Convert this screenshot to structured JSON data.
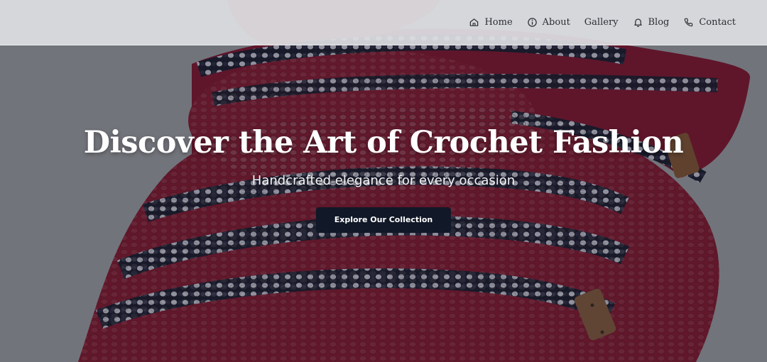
{
  "nav": {
    "items": [
      {
        "label": "Home",
        "icon": "home-icon"
      },
      {
        "label": "About",
        "icon": "info-icon"
      },
      {
        "label": "Gallery",
        "icon": ""
      },
      {
        "label": "Blog",
        "icon": "bell-icon"
      },
      {
        "label": "Contact",
        "icon": "phone-icon"
      }
    ]
  },
  "hero": {
    "title": "Discover the Art of Crochet Fashion",
    "subtitle": "Handcrafted elegance for every occasion",
    "cta_label": "Explore Our Collection"
  },
  "colors": {
    "hat_red": "#8e1530",
    "stripe_white": "#d8d8e6",
    "stripe_navy": "#14162a",
    "button_bg": "#111827",
    "navbar_bg": "#dedfe2"
  }
}
